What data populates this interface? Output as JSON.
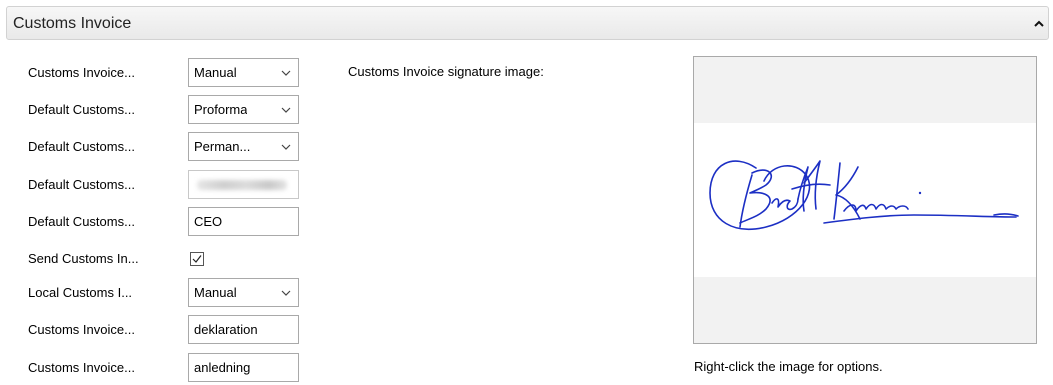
{
  "section": {
    "title": "Customs Invoice",
    "collapse_icon": "chevron-up-icon"
  },
  "fields": [
    {
      "label": "Customs Invoice...",
      "type": "select",
      "value": "Manual"
    },
    {
      "label": "Default Customs...",
      "type": "select",
      "value": "Proforma"
    },
    {
      "label": "Default Customs...",
      "type": "select",
      "value": "Perman..."
    },
    {
      "label": "Default Customs...",
      "type": "text",
      "value": "",
      "note": "blurred"
    },
    {
      "label": "Default Customs...",
      "type": "text",
      "value": "CEO"
    },
    {
      "label": "Send Customs In...",
      "type": "checkbox",
      "checked": true
    },
    {
      "label": "Local Customs I...",
      "type": "select",
      "value": "Manual"
    },
    {
      "label": "Customs Invoice...",
      "type": "text",
      "value": "deklaration"
    },
    {
      "label": "Customs Invoice...",
      "type": "text",
      "value": "anledning"
    }
  ],
  "signature": {
    "label": "Customs Invoice signature image:",
    "hint": "Right-click the image for options.",
    "ink_color": "#1c2fc4"
  }
}
